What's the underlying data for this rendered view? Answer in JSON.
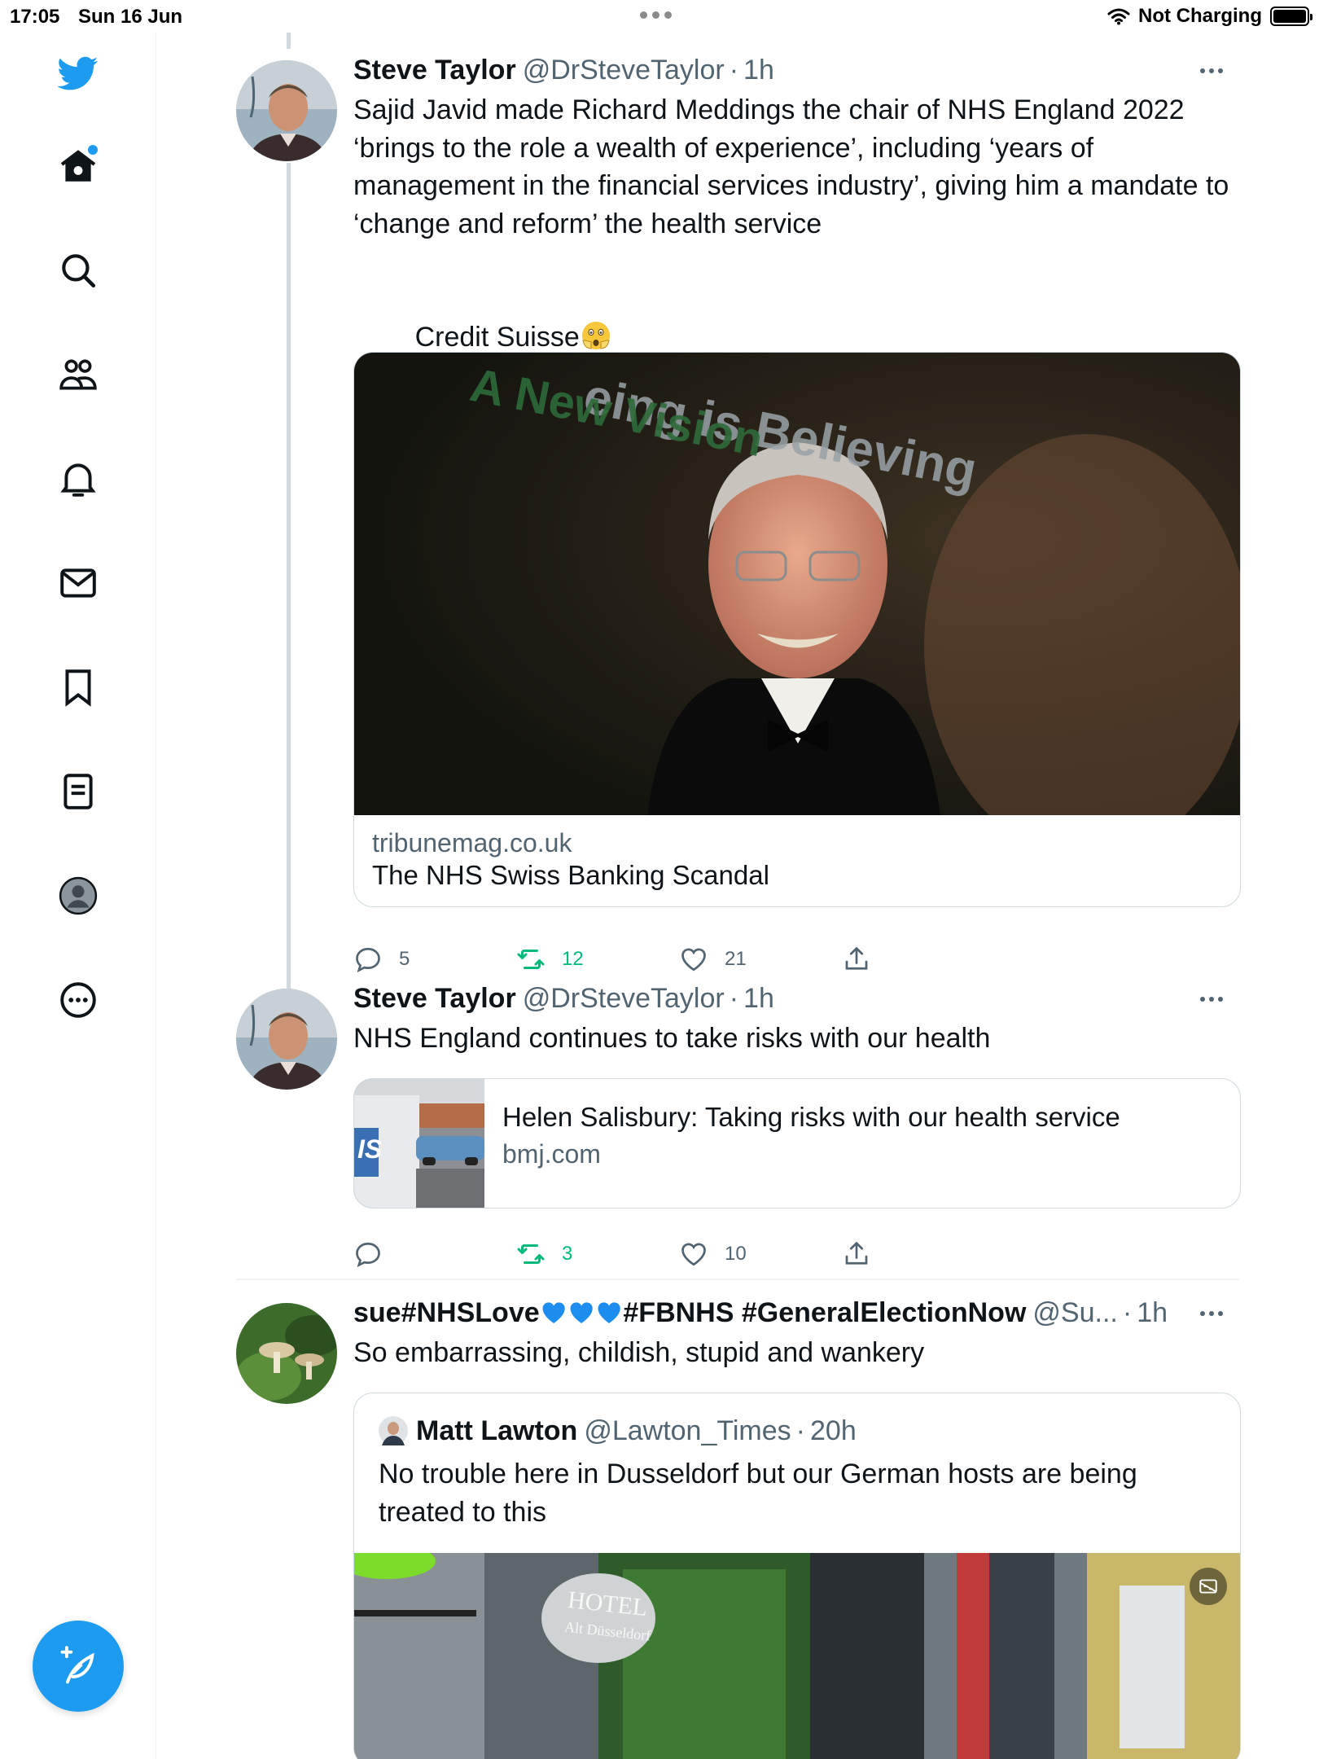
{
  "status_bar": {
    "time": "17:05",
    "date": "Sun 16 Jun",
    "battery_text": "Not Charging"
  },
  "sidebar": {
    "items": [
      {
        "icon": "twitter-bird-icon"
      },
      {
        "icon": "home-icon"
      },
      {
        "icon": "search-icon"
      },
      {
        "icon": "communities-icon"
      },
      {
        "icon": "notifications-icon"
      },
      {
        "icon": "messages-icon"
      },
      {
        "icon": "bookmarks-icon"
      },
      {
        "icon": "lists-icon"
      },
      {
        "icon": "profile-icon"
      },
      {
        "icon": "more-icon"
      }
    ],
    "compose_icon": "compose-icon"
  },
  "colors": {
    "accent": "#1d9bf0",
    "text": "#0f1419",
    "secondary": "#536471",
    "retweet_active": "#00ba7c",
    "border": "#cfd9de"
  },
  "tweets": [
    {
      "name": "Steve Taylor",
      "handle": "@DrSteveTaylor",
      "time": "1h",
      "text": "Sajid Javid made Richard Meddings the chair of NHS England 2022 ‘brings to the role a wealth of experience’, including ‘years of management in the financial services industry’, giving him a mandate to ‘change and reform’ the health service",
      "text2": "Credit Suisse",
      "card": {
        "image_text_1": "eing is Believing",
        "image_text_2": "A New Vision",
        "domain": "tribunemag.co.uk",
        "title": "The NHS Swiss Banking Scandal"
      },
      "replies": "5",
      "retweets": "12",
      "likes": "21"
    },
    {
      "name": "Steve Taylor",
      "handle": "@DrSteveTaylor",
      "time": "1h",
      "text": "NHS England continues to take risks with our health",
      "card": {
        "thumb_text": "IS",
        "title": "Helen Salisbury: Taking risks with our health service",
        "domain": "bmj.com"
      },
      "replies": "",
      "retweets": "3",
      "likes": "10"
    },
    {
      "name_part1": "sue#NHSLove",
      "name_part2": "#FBNHS #GeneralElectionNow",
      "handle": "@Su...",
      "time": "1h",
      "text": "So embarrassing, childish, stupid and wankery",
      "quote": {
        "name": "Matt Lawton",
        "handle": "@Lawton_Times",
        "time": "20h",
        "text": "No trouble here in Dusseldorf but our German hosts are being treated to this",
        "image_text_1": "HOTEL",
        "image_text_2": "Alt Düsseldorf"
      }
    }
  ]
}
